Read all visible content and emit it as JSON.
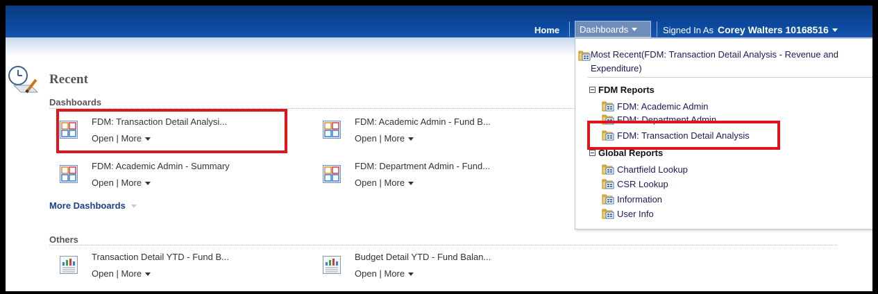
{
  "topbar": {
    "home": "Home",
    "dashboards": "Dashboards",
    "signed_in_as": "Signed In As",
    "user": "Corey Walters 10168516"
  },
  "recent": {
    "title": "Recent",
    "dashboards_heading": "Dashboards",
    "dashboards": [
      {
        "name": "FDM: Transaction Detail Analysi...",
        "open": "Open",
        "more": "More"
      },
      {
        "name": "FDM: Academic Admin - Fund B...",
        "open": "Open",
        "more": "More"
      },
      {
        "name": "FDM: Academic Admin - Summary",
        "open": "Open",
        "more": "More"
      },
      {
        "name": "FDM: Department Admin - Fund...",
        "open": "Open",
        "more": "More"
      }
    ],
    "more_dashboards": "More Dashboards",
    "others_heading": "Others",
    "others": [
      {
        "name": "Transaction Detail YTD - Fund B...",
        "open": "Open",
        "more": "More"
      },
      {
        "name": "Budget Detail YTD - Fund Balan...",
        "open": "Open",
        "more": "More"
      }
    ],
    "separator": "|"
  },
  "menu": {
    "most_recent": "Most Recent(FDM: Transaction Detail Analysis - Revenue and Expenditure)",
    "groups": [
      {
        "label": "FDM Reports",
        "items": [
          "FDM: Academic Admin",
          "FDM: Department Admin",
          "FDM: Transaction Detail Analysis"
        ]
      },
      {
        "label": "Global Reports",
        "items": [
          "Chartfield Lookup",
          "CSR Lookup",
          "Information",
          "User Info"
        ]
      }
    ]
  },
  "colors": {
    "topbar": "#0b4aa0",
    "highlight": "#e0141b",
    "link": "#1a3f8a"
  }
}
